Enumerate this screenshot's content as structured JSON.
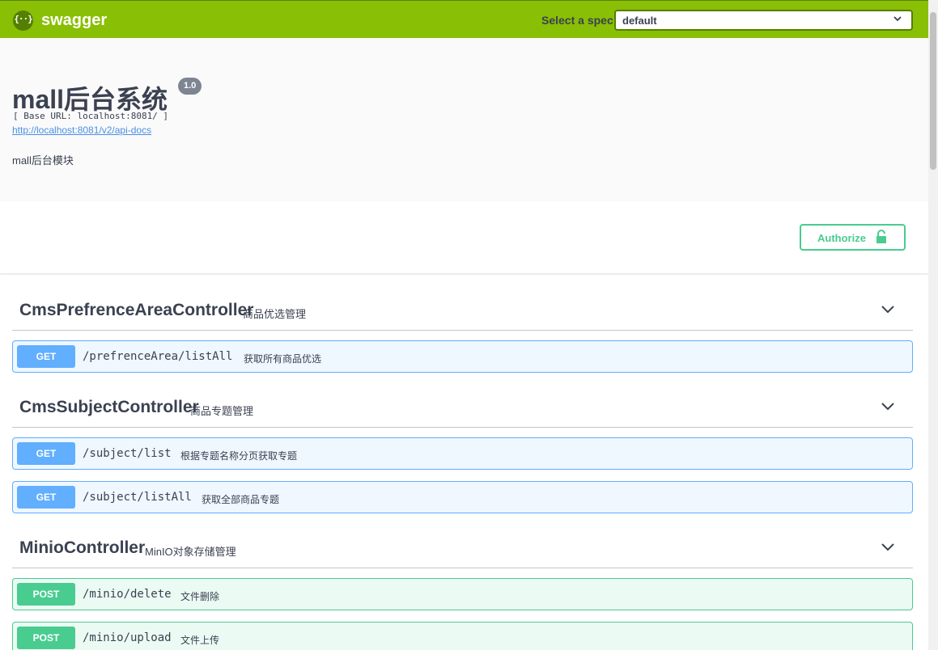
{
  "topbar": {
    "logo_text": "swagger",
    "spec_label": "Select a spec",
    "spec_value": "default"
  },
  "info": {
    "title": "mall后台系统",
    "version": "1.0",
    "base_url": "[ Base URL: localhost:8081/ ]",
    "api_docs_link": "http://localhost:8081/v2/api-docs",
    "description": "mall后台模块"
  },
  "scheme": {
    "authorize_label": "Authorize"
  },
  "tags": [
    {
      "name": "CmsPrefrenceAreaController",
      "description": "商品优选管理",
      "operations": [
        {
          "method": "GET",
          "path": "/prefrenceArea/listAll",
          "summary": "获取所有商品优选"
        }
      ]
    },
    {
      "name": "CmsSubjectController",
      "description": "商品专题管理",
      "operations": [
        {
          "method": "GET",
          "path": "/subject/list",
          "summary": "根据专题名称分页获取专题"
        },
        {
          "method": "GET",
          "path": "/subject/listAll",
          "summary": "获取全部商品专题"
        }
      ]
    },
    {
      "name": "MinioController",
      "description": "MinIO对象存储管理",
      "operations": [
        {
          "method": "POST",
          "path": "/minio/delete",
          "summary": "文件删除"
        },
        {
          "method": "POST",
          "path": "/minio/upload",
          "summary": "文件上传"
        }
      ]
    }
  ],
  "colors": {
    "topbar": "#89bf04",
    "get": "#61affe",
    "post": "#49cc90",
    "text": "#3b4151"
  },
  "icons": {
    "logo": "swagger-logo-icon",
    "spec_dropdown": "chevron-down-icon",
    "authorize": "lock-icon",
    "tag_toggle": "chevron-down-icon"
  }
}
